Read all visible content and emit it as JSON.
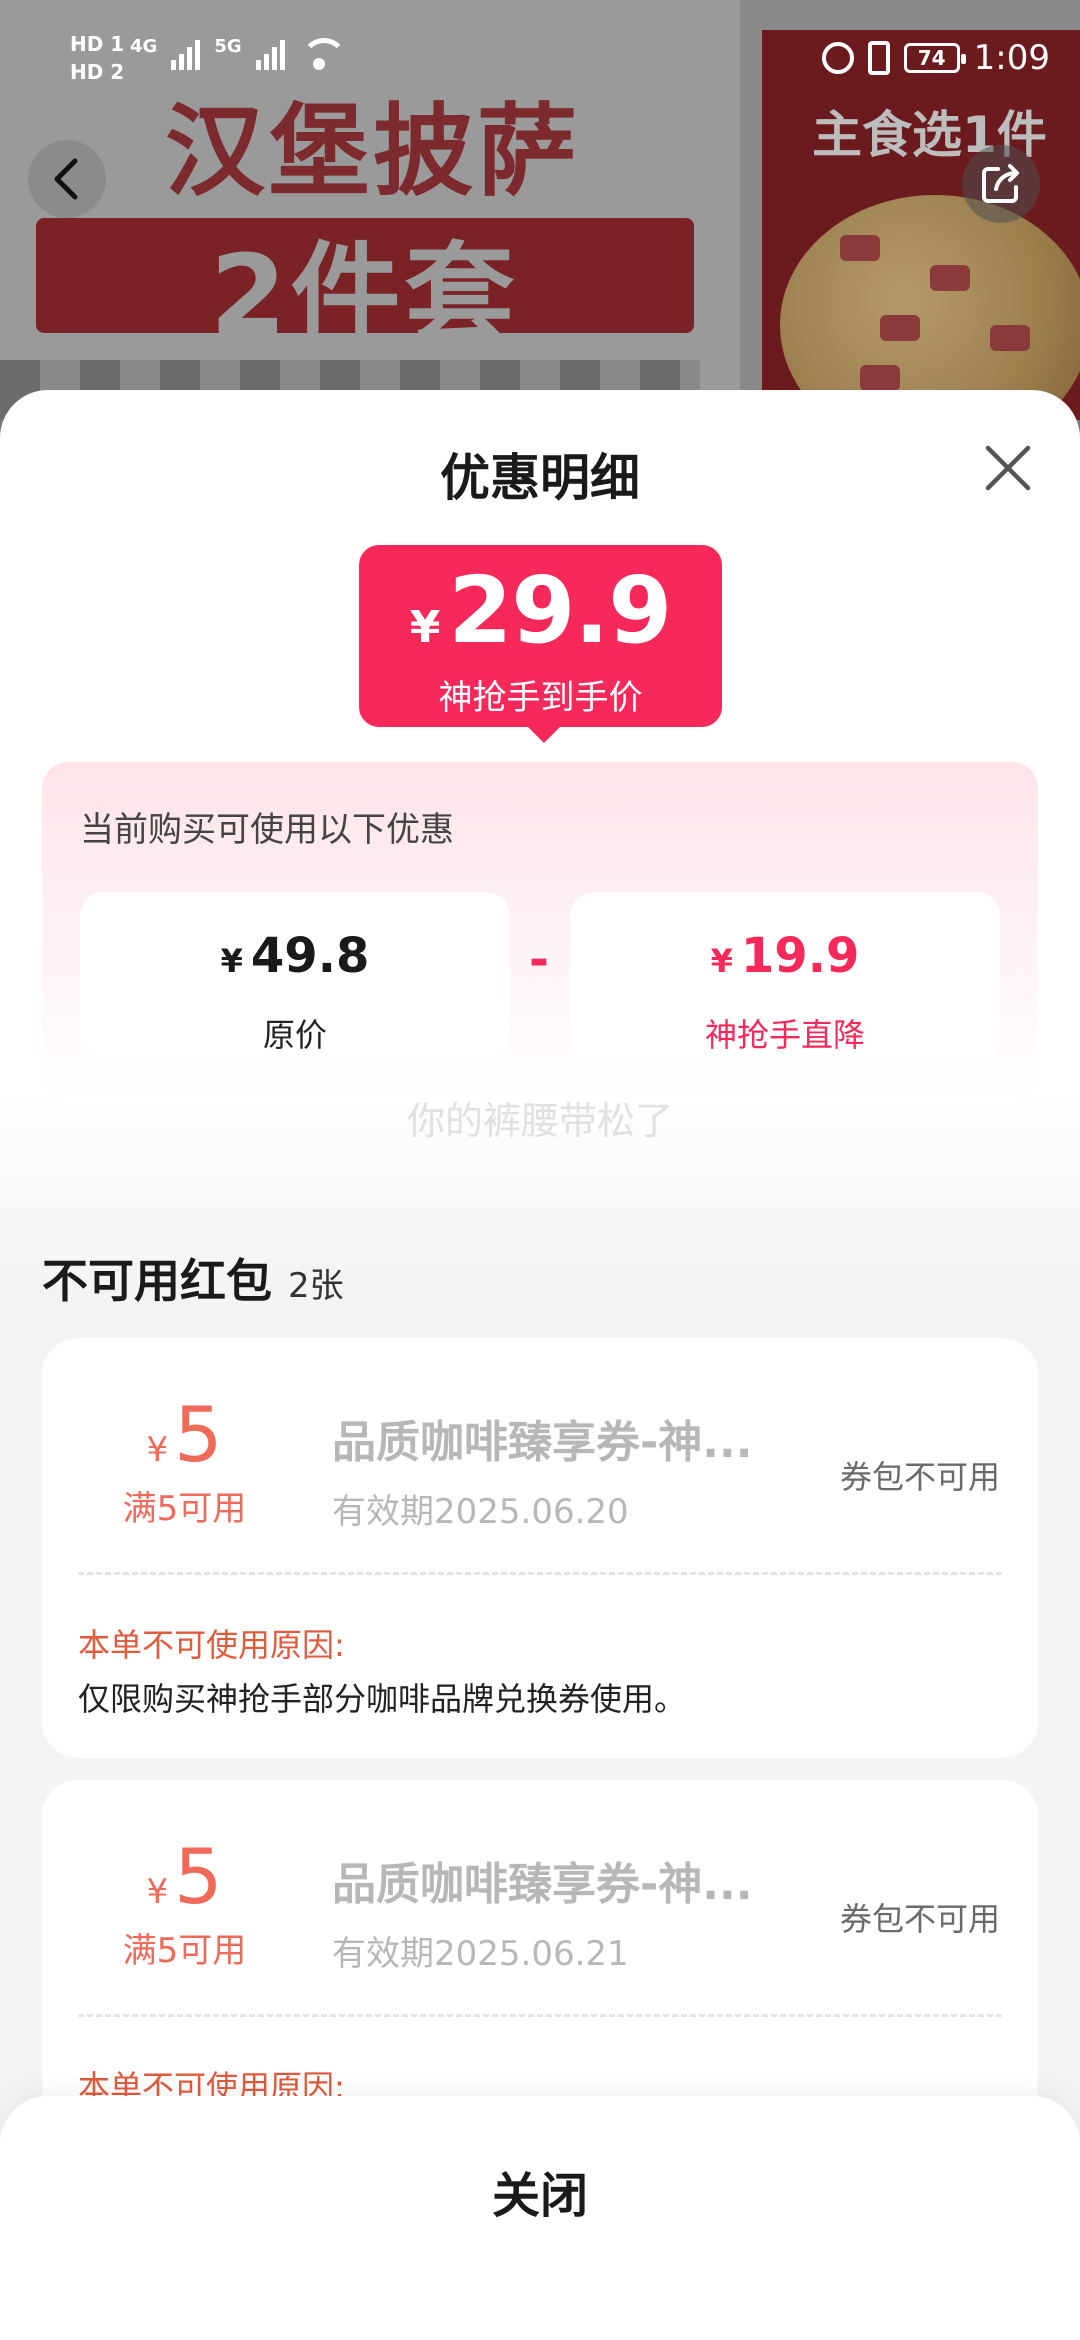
{
  "background": {
    "banner_title_line1": "汉堡披萨",
    "banner_title_line2": "2件套",
    "banner_right_text": "主食选1件"
  },
  "status_bar": {
    "sim1": "HD 1",
    "sim2": "HD 2",
    "net1": "4G",
    "net2": "5G",
    "battery": "74",
    "time": "1:09"
  },
  "sheet": {
    "title": "优惠明细",
    "final_price": {
      "symbol": "¥",
      "value": "29.9",
      "label": "神抢手到手价"
    },
    "discounts": {
      "heading": "当前购买可使用以下优惠",
      "original": {
        "symbol": "¥",
        "value": "49.8",
        "label": "原价"
      },
      "operator": "-",
      "reduction": {
        "symbol": "¥",
        "value": "19.9",
        "label": "神抢手直降"
      }
    },
    "watermark": "你的裤腰带松了",
    "unavailable": {
      "title": "不可用红包",
      "count": "2张",
      "coupons": [
        {
          "symbol": "¥",
          "amount": "5",
          "condition": "满5可用",
          "name": "品质咖啡臻享券-神...",
          "validity": "有效期2025.06.20",
          "status": "券包不可用",
          "reason_label": "本单不可使用原因:",
          "reason_text": "仅限购买神抢手部分咖啡品牌兑换券使用。"
        },
        {
          "symbol": "¥",
          "amount": "5",
          "condition": "满5可用",
          "name": "品质咖啡臻享券-神...",
          "validity": "有效期2025.06.21",
          "status": "券包不可用",
          "reason_label": "本单不可使用原因:"
        }
      ]
    },
    "close_button": "关闭"
  },
  "colors": {
    "accent": "#f7285a",
    "coupon_amount": "#f06a5a",
    "reason_label": "#e05a3c"
  },
  "icons": [
    "back-arrow-icon",
    "share-icon",
    "close-icon",
    "wifi-icon",
    "alarm-icon",
    "vibrate-icon",
    "battery-icon"
  ]
}
